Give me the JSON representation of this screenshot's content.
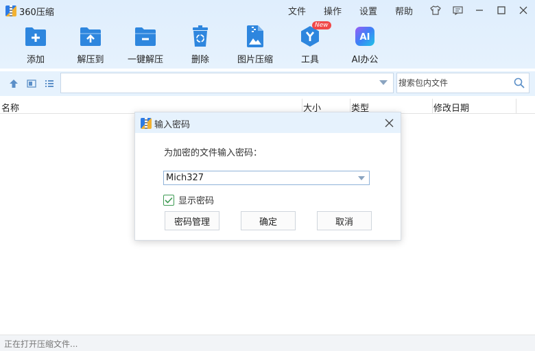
{
  "app": {
    "title": "360压缩"
  },
  "menu": [
    "文件",
    "操作",
    "设置",
    "帮助"
  ],
  "window_controls": [
    "skin-icon",
    "feedback-icon",
    "minimize-icon",
    "maximize-icon",
    "close-icon"
  ],
  "toolbar": {
    "items": [
      {
        "label": "添加",
        "icon": "add-folder-icon"
      },
      {
        "label": "解压到",
        "icon": "extract-to-icon"
      },
      {
        "label": "一键解压",
        "icon": "one-click-extract-icon"
      },
      {
        "label": "删除",
        "icon": "delete-icon"
      },
      {
        "label": "图片压缩",
        "icon": "image-compress-icon"
      },
      {
        "label": "工具",
        "icon": "tools-icon",
        "badge": "New"
      },
      {
        "label": "AI办公",
        "icon": "ai-office-icon",
        "icon_text": "AI"
      }
    ]
  },
  "address_bar": {
    "path": "",
    "search_placeholder": "搜索包内文件"
  },
  "columns": [
    "名称",
    "大小",
    "类型",
    "修改日期"
  ],
  "status": {
    "text": "正在打开压缩文件..."
  },
  "dialog": {
    "title": "输入密码",
    "prompt": "为加密的文件输入密码：",
    "password": "Mich327",
    "show_password_label": "显示密码",
    "show_password_checked": true,
    "buttons": {
      "manage": "密码管理",
      "ok": "确定",
      "cancel": "取消"
    }
  },
  "colors": {
    "accent": "#2e86de",
    "header_bg": "#e3f0fd",
    "checkbox": "#3d9a52",
    "badge": "#f04848"
  }
}
